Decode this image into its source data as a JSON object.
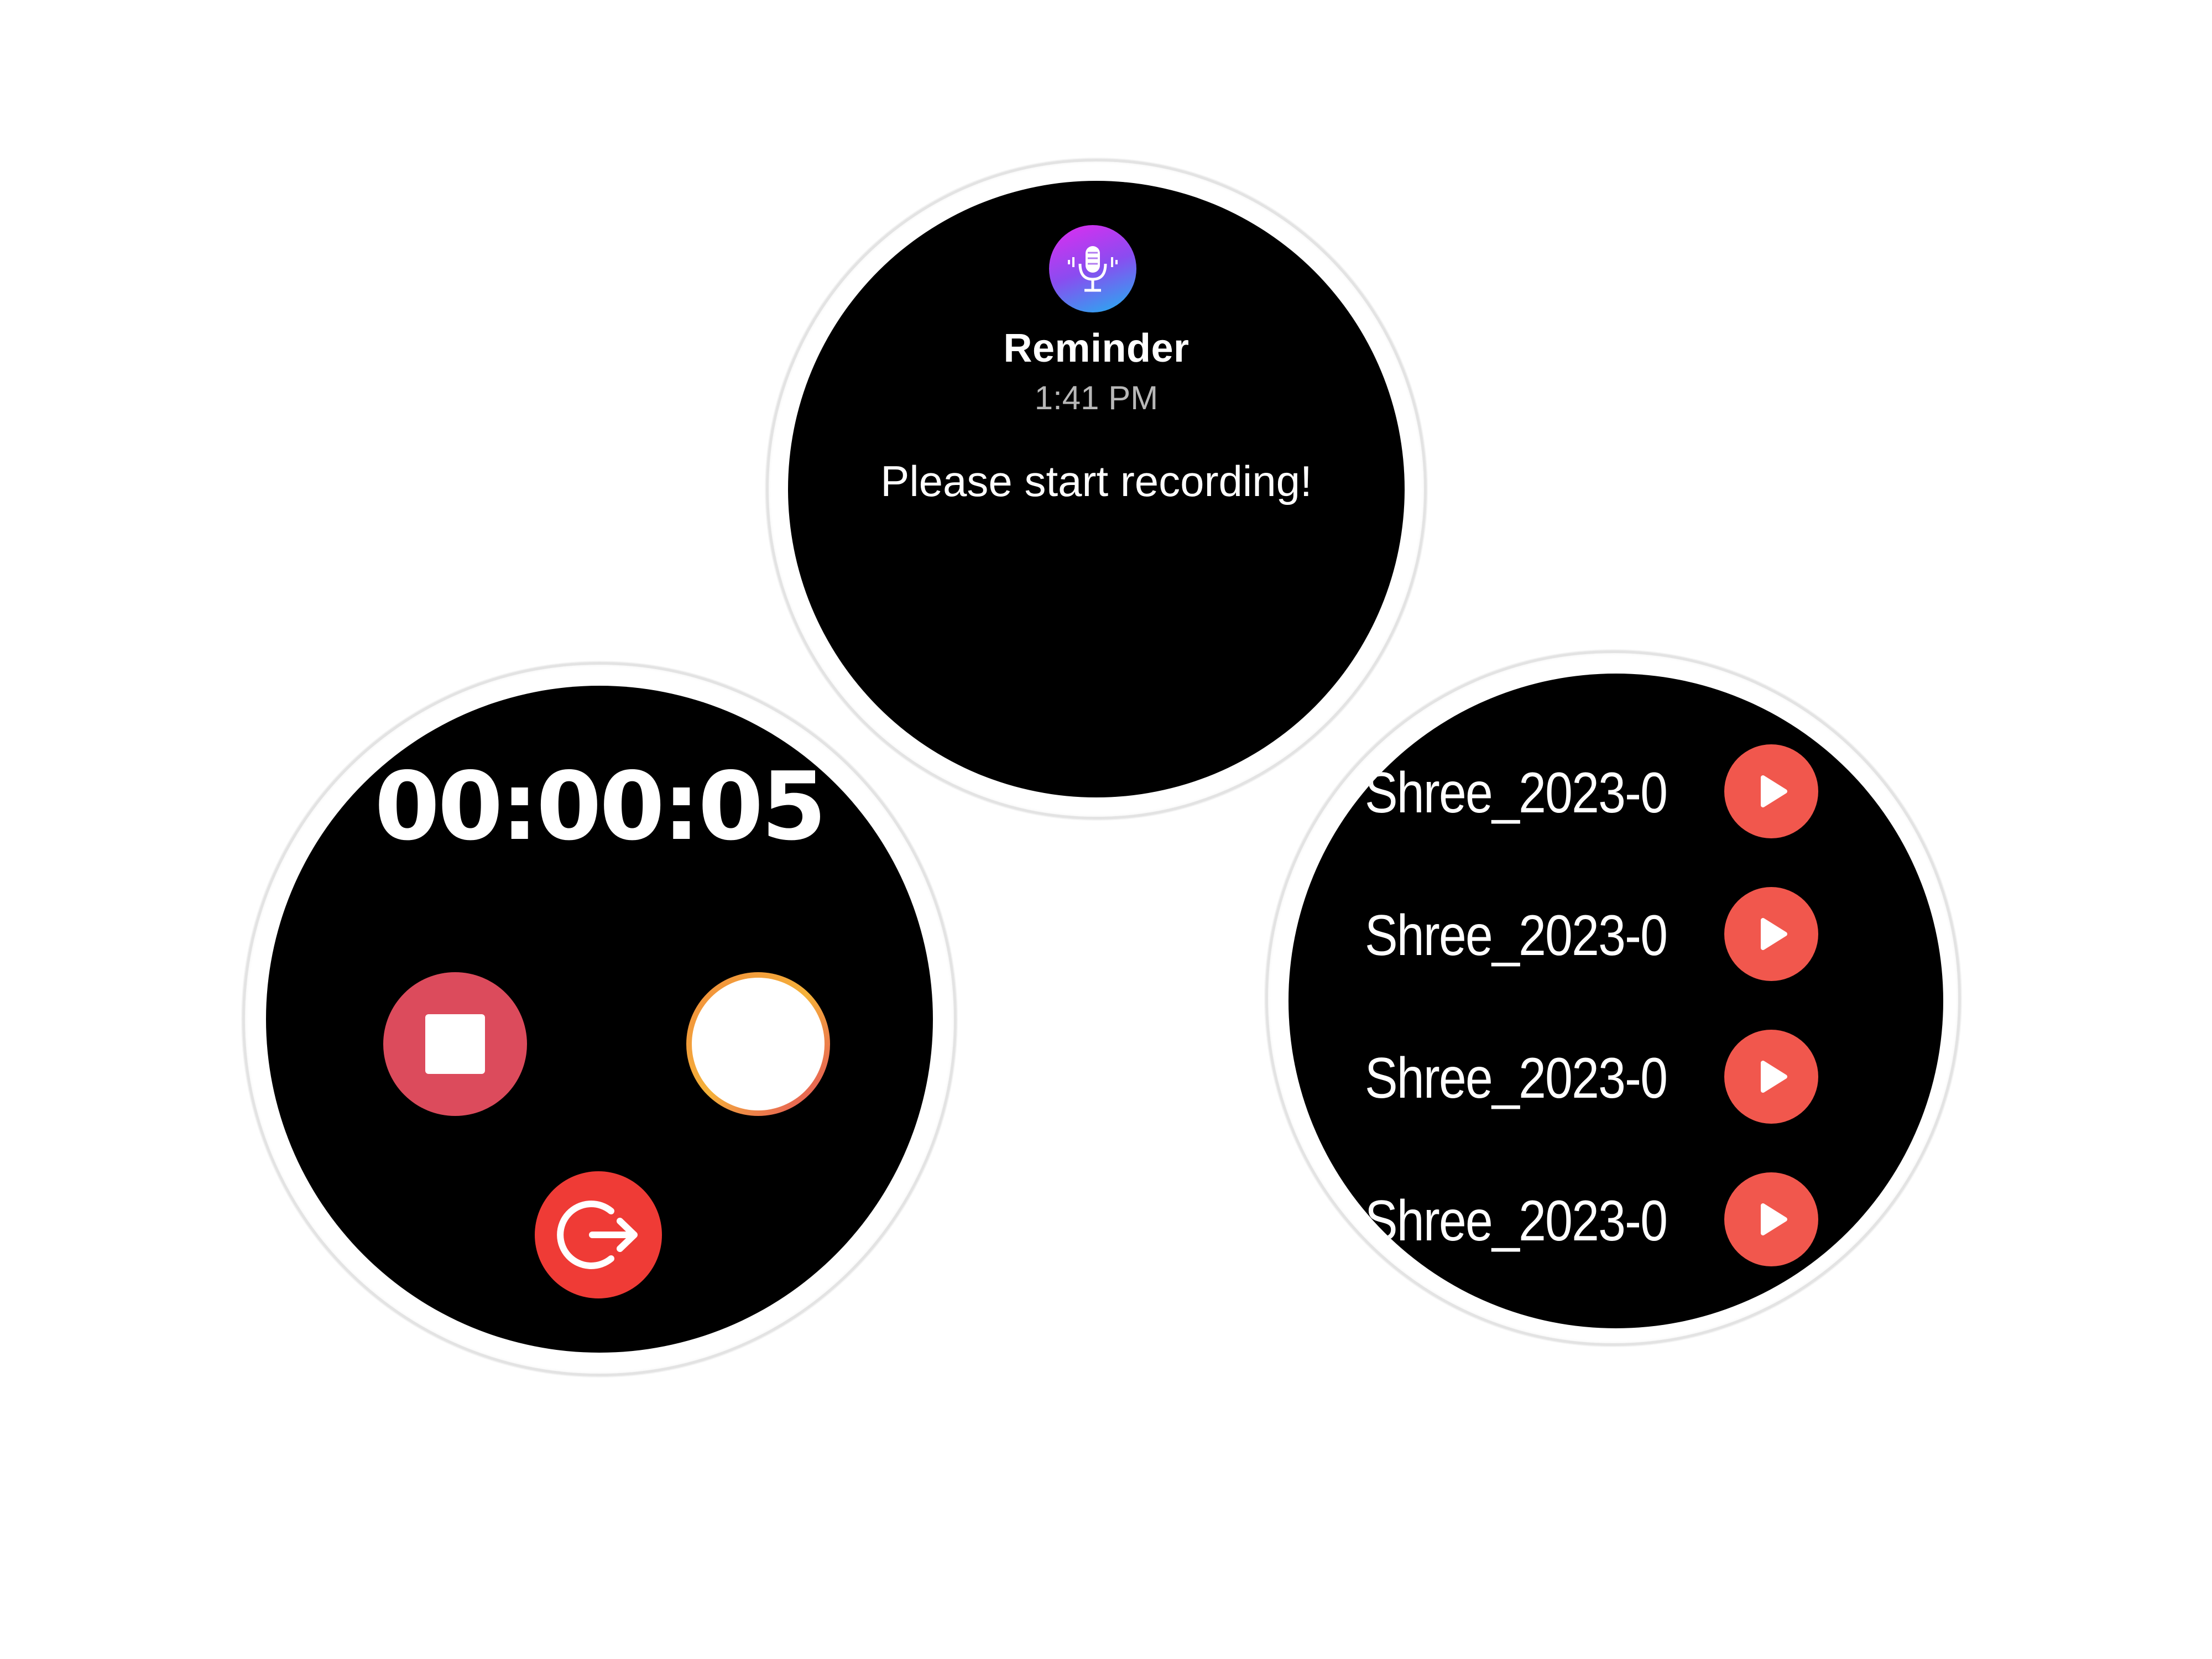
{
  "reminder_watch": {
    "app_icon": "microphone-icon",
    "title": "Reminder",
    "time": "1:41 PM",
    "message": "Please start recording!",
    "colors": {
      "icon_gradient_start": "#e02cf0",
      "icon_gradient_end": "#1fb3f0"
    }
  },
  "recorder_watch": {
    "timer": "00:00:05",
    "buttons": [
      {
        "name": "stop-button",
        "icon": "stop-icon",
        "color": "#dc4b5c"
      },
      {
        "name": "recordings-list-button",
        "icon": "menu-lines-icon",
        "color": "#f08a3c"
      },
      {
        "name": "exit-button",
        "icon": "exit-icon",
        "color": "#ef3b36"
      }
    ]
  },
  "recordings_watch": {
    "recordings": [
      {
        "name": "Shree_2023-0..",
        "action_icon": "play-icon"
      },
      {
        "name": "Shree_2023-0..",
        "action_icon": "play-icon"
      },
      {
        "name": "Shree_2023-0..",
        "action_icon": "play-icon"
      },
      {
        "name": "Shree_2023-0..",
        "action_icon": "play-icon"
      }
    ],
    "colors": {
      "play_button": "#f1574d"
    }
  }
}
